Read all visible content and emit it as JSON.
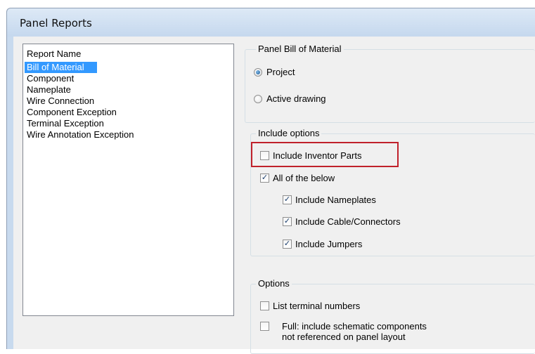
{
  "window": {
    "title": "Panel Reports"
  },
  "report_list": {
    "header": "Report Name",
    "items": [
      {
        "label": "Bill of Material",
        "selected": true
      },
      {
        "label": "Component",
        "selected": false
      },
      {
        "label": "Nameplate",
        "selected": false
      },
      {
        "label": "Wire Connection",
        "selected": false
      },
      {
        "label": "Component Exception",
        "selected": false
      },
      {
        "label": "Terminal Exception",
        "selected": false
      },
      {
        "label": "Wire Annotation Exception",
        "selected": false
      }
    ]
  },
  "bom_group": {
    "label": "Panel Bill of Material",
    "options": [
      {
        "label": "Project",
        "selected": true
      },
      {
        "label": "Active drawing",
        "selected": false
      }
    ]
  },
  "include_group": {
    "label": "Include options",
    "include_inventor_parts": {
      "label": "Include Inventor Parts",
      "checked": false
    },
    "all_of_below": {
      "label": "All of the below",
      "checked": true
    },
    "include_nameplates": {
      "label": "Include Nameplates",
      "checked": true
    },
    "include_cable_connectors": {
      "label": "Include Cable/Connectors",
      "checked": true
    },
    "include_jumpers": {
      "label": "Include Jumpers",
      "checked": true
    }
  },
  "options_group": {
    "label": "Options",
    "list_terminal_numbers": {
      "label": "List terminal numbers",
      "checked": false
    },
    "full_include": {
      "label": "Full: include schematic components\nnot referenced on panel layout",
      "checked": false
    }
  },
  "colors": {
    "selection": "#3399ff",
    "highlight_border": "#c0212b"
  }
}
